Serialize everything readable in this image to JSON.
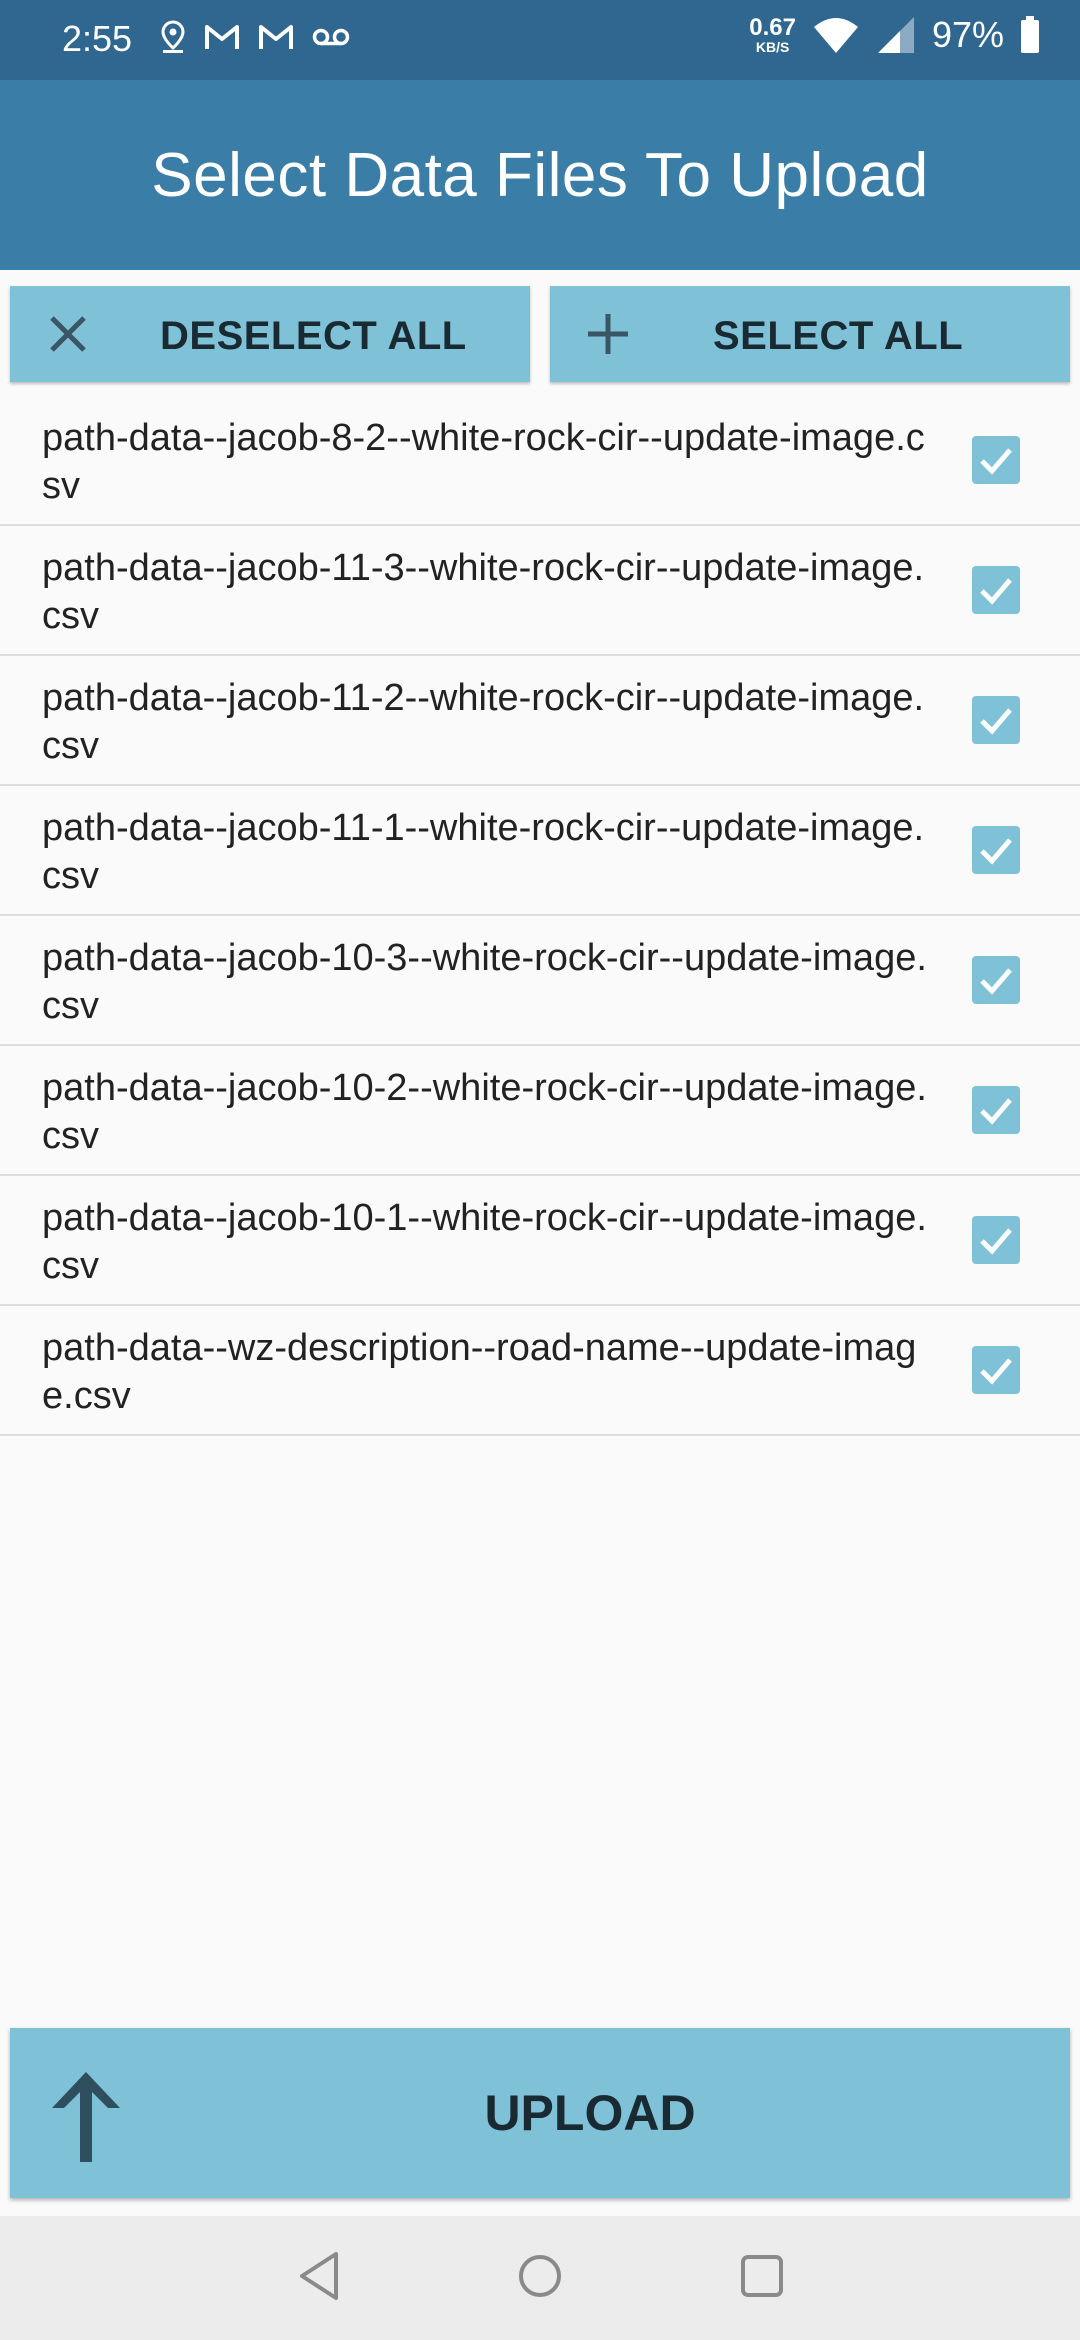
{
  "status_bar": {
    "time": "2:55",
    "net_speed": "0.67",
    "net_unit": "KB/S",
    "battery": "97%",
    "icons": [
      "location-icon",
      "gmail-icon",
      "gmail-icon",
      "voicemail-icon",
      "wifi-icon",
      "signal-icon",
      "battery-icon"
    ]
  },
  "header": {
    "title": "Select Data Files To Upload"
  },
  "actions": {
    "deselect_all": "DESELECT ALL",
    "select_all": "SELECT ALL"
  },
  "files": [
    {
      "name": "path-data--jacob-8-2--white-rock-cir--update-image.csv",
      "checked": true
    },
    {
      "name": "path-data--jacob-11-3--white-rock-cir--update-image.csv",
      "checked": true
    },
    {
      "name": "path-data--jacob-11-2--white-rock-cir--update-image.csv",
      "checked": true
    },
    {
      "name": "path-data--jacob-11-1--white-rock-cir--update-image.csv",
      "checked": true
    },
    {
      "name": "path-data--jacob-10-3--white-rock-cir--update-image.csv",
      "checked": true
    },
    {
      "name": "path-data--jacob-10-2--white-rock-cir--update-image.csv",
      "checked": true
    },
    {
      "name": "path-data--jacob-10-1--white-rock-cir--update-image.csv",
      "checked": true
    },
    {
      "name": "path-data--wz-description--road-name--update-image.csv",
      "checked": true
    }
  ],
  "upload": {
    "label": "UPLOAD"
  },
  "colors": {
    "status_bar": "#2f6791",
    "app_bar": "#3a7ea8",
    "button": "#7fc1d7",
    "icon_dark": "#2f4f5f"
  }
}
